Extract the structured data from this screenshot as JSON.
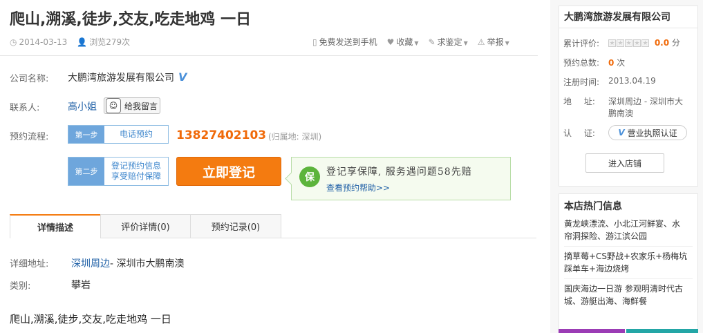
{
  "page": {
    "title": "爬山,溯溪,徒步,交友,吃走地鸡 一日",
    "date": "2014-03-13",
    "views": "浏览279次"
  },
  "actions": {
    "send_phone": "免费发送到手机",
    "favorite": "收藏",
    "appraise": "求鉴定",
    "report": "举报"
  },
  "info": {
    "company_label": "公司名称:",
    "company_name": "大鹏湾旅游发展有限公司",
    "contact_label": "联系人:",
    "contact_name": "高小姐",
    "message_btn": "给我留言",
    "flow_label": "预约流程:",
    "step1_num": "第一步",
    "step1_text": "电话预约",
    "phone": "13827402103",
    "region": "(归属地: 深圳)",
    "step2_num": "第二步",
    "step2_line1": "登记预约信息",
    "step2_line2": "享受赔付保障",
    "register_btn": "立即登记",
    "guard_icon": "保",
    "guard_text": "登记享保障, 服务遇问题58先赔",
    "guard_link": "查看预约帮助>>"
  },
  "tabs": [
    {
      "label": "详情描述"
    },
    {
      "label": "评价详情(0)"
    },
    {
      "label": "预约记录(0)"
    }
  ],
  "detail": {
    "address_label": "详细地址:",
    "address_link": "深圳周边",
    "address_rest": "- 深圳市大鹏南澳",
    "category_label": "类别:",
    "category_value": "攀岩",
    "body_line1": "爬山,溯溪,徒步,交友,吃走地鸡 一日"
  },
  "sidebar": {
    "company": "大鹏湾旅游发展有限公司",
    "rating_label": "累计评价:",
    "rating_value": "0.0",
    "rating_unit": "分",
    "bookings_label": "预约总数:",
    "bookings_value": "0",
    "bookings_unit": "次",
    "registered_label": "注册时间:",
    "registered_value": "2013.04.19",
    "addr_label": "地 址:",
    "addr_line1": "深圳周边 - 深圳市大",
    "addr_line2": "鹏南澳",
    "cert_label": "认 证:",
    "cert_text": "营业执照认证",
    "enter_shop": "进入店铺",
    "hot_title": "本店热门信息",
    "hot_items": [
      {
        "line1": "黄龙峡漂流、小北江河鲜宴、水",
        "line2": "帘洞探险、游江滨公园"
      },
      {
        "line1": "摘草莓+CS野战+农家乐+杨梅坑",
        "line2": "踩单车+海边烧烤"
      },
      {
        "line1": "国庆海边一日游 参观明清时代古",
        "line2": "城、游艇出海、海鲜餐"
      }
    ]
  },
  "colors": {
    "accent_orange": "#f47b10",
    "link_blue": "#1e5fa6",
    "step_blue": "#6ea6dc",
    "guard_green": "#5cb43c"
  }
}
